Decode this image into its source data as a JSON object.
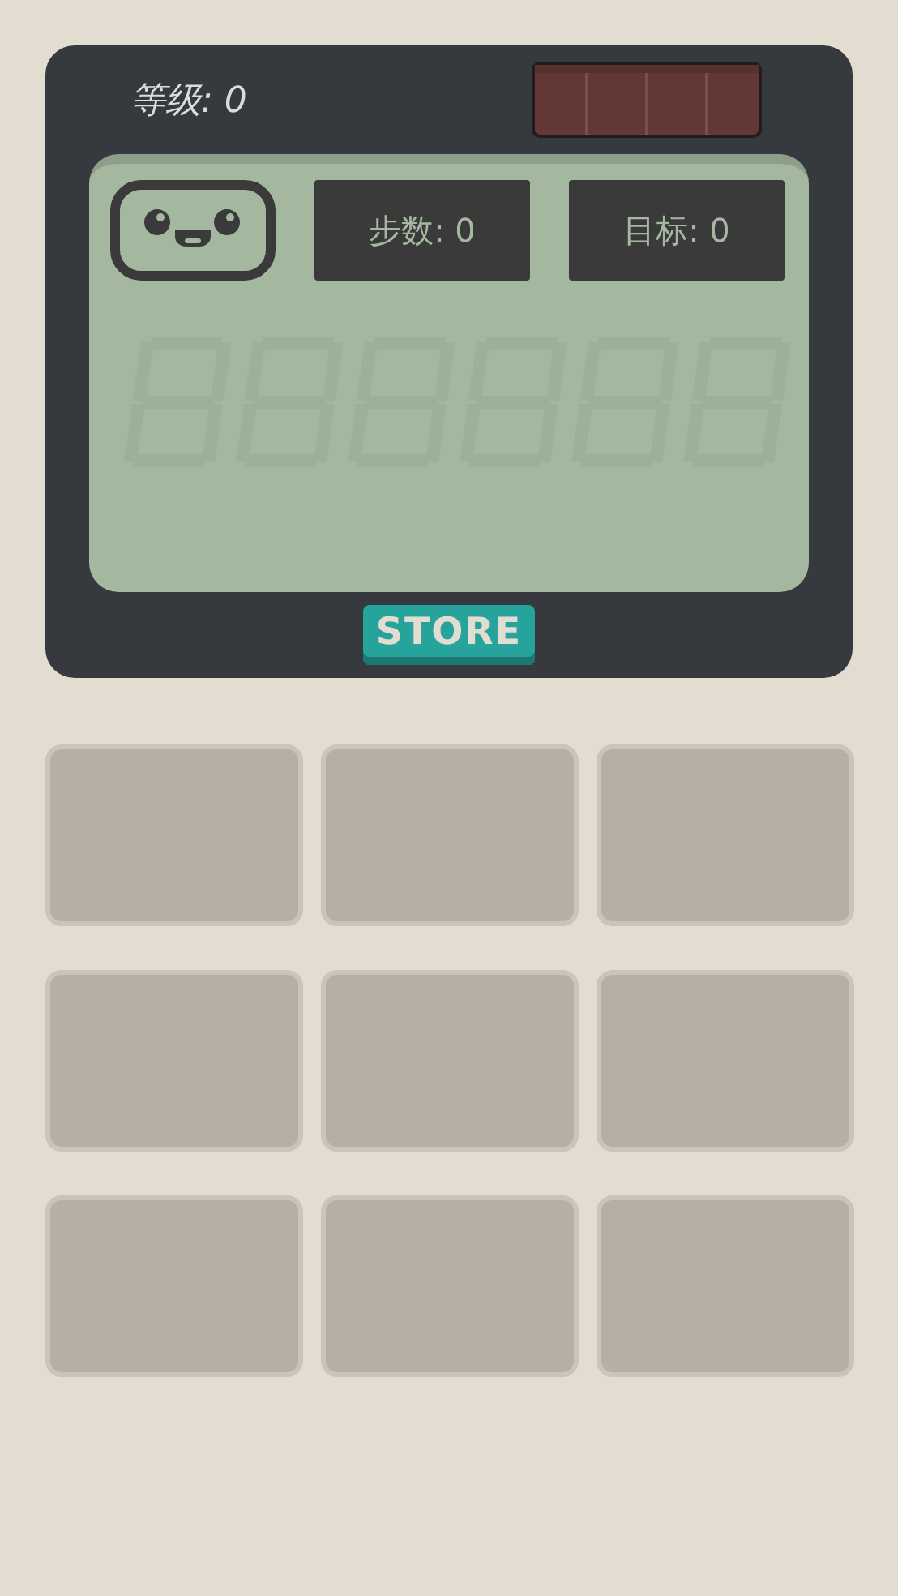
{
  "level_label": "等级: 0",
  "stats": [
    {
      "label": "步数: 0"
    },
    {
      "label": "目标: 0"
    }
  ],
  "store_button": "STORE"
}
